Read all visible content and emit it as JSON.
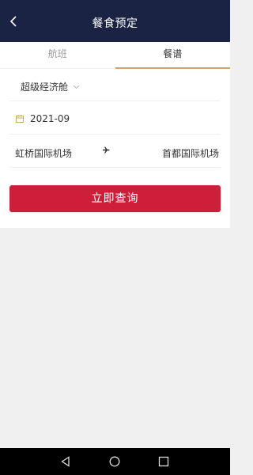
{
  "header": {
    "title": "餐食预定",
    "back_icon": "back-chevron-icon"
  },
  "tabs": [
    {
      "label": "航班",
      "active": false
    },
    {
      "label": "餐谱",
      "active": true
    }
  ],
  "form": {
    "cabin": "超级经济舱",
    "date": "2021-09",
    "origin": "虹桥国际机场",
    "destination": "首都国际机场",
    "submit_label": "立即查询"
  },
  "colors": {
    "header_bg": "#1b2344",
    "accent": "#cd1f3a",
    "tab_underline": "#c9a86a"
  },
  "system_nav": {
    "icons": [
      "nav-back-icon",
      "nav-home-icon",
      "nav-recent-icon"
    ]
  }
}
